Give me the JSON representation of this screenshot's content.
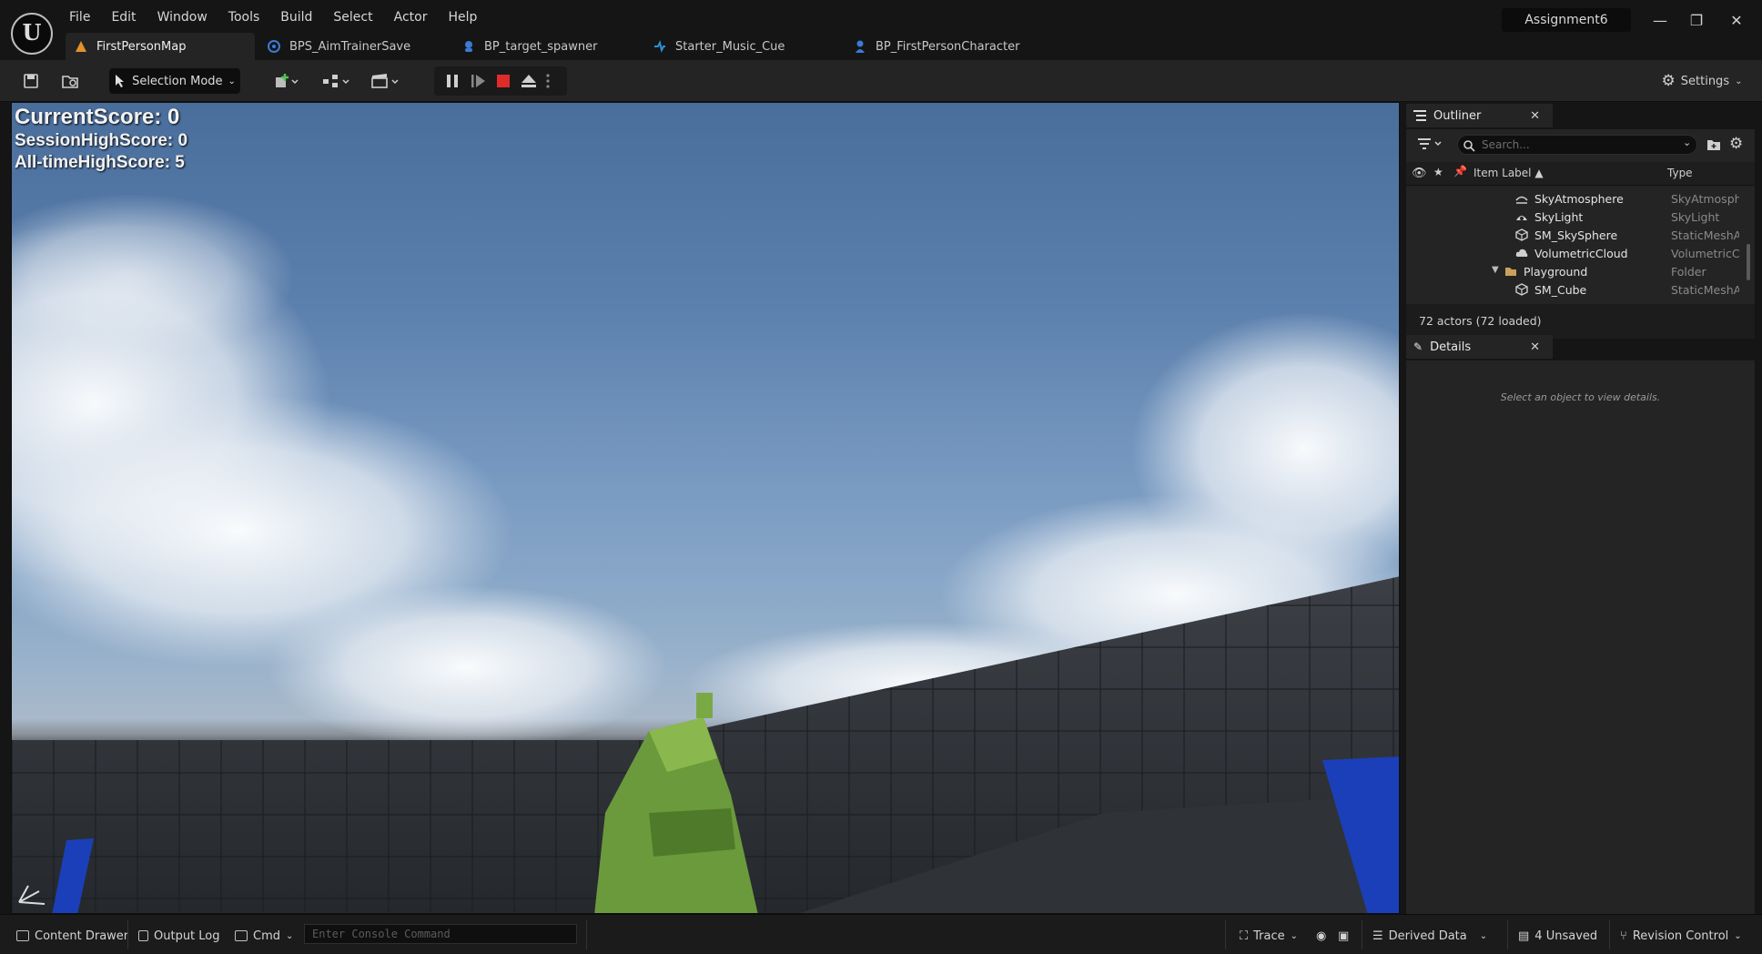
{
  "app": {
    "project_name": "Assignment6",
    "logo_glyph": "U",
    "menu": [
      "File",
      "Edit",
      "Window",
      "Tools",
      "Build",
      "Select",
      "Actor",
      "Help"
    ],
    "window_controls": {
      "minimize": "—",
      "restore": "❐",
      "close": "✕"
    }
  },
  "tabs": [
    {
      "label": "FirstPersonMap",
      "icon": "level-icon",
      "color": "#e0922c",
      "active": true
    },
    {
      "label": "BPS_AimTrainerSave",
      "icon": "savegame-blueprint-icon",
      "color": "#3a7bd5"
    },
    {
      "label": "BP_target_spawner",
      "icon": "actor-blueprint-icon",
      "color": "#3a7bd5"
    },
    {
      "label": "Starter_Music_Cue",
      "icon": "sound-cue-icon",
      "color": "#2f8fd8"
    },
    {
      "label": "BP_FirstPersonCharacter",
      "icon": "character-blueprint-icon",
      "color": "#3a7bd5"
    }
  ],
  "toolbar": {
    "selection_mode": "Selection Mode",
    "settings": "Settings",
    "stop_color": "#e02b2b"
  },
  "hud": {
    "current_score": "CurrentScore: 0",
    "session_high": "SessionHighScore: 0",
    "alltime_high": "All-timeHighScore: 5"
  },
  "outliner": {
    "title": "Outliner",
    "search_placeholder": "Search...",
    "columns": {
      "label": "Item Label ▲",
      "type": "Type"
    },
    "rows": [
      {
        "label": "SkyAtmosphere",
        "type": "SkyAtmosphere",
        "icon": "sky-atmosphere-icon"
      },
      {
        "label": "SkyLight",
        "type": "SkyLight",
        "icon": "skylight-icon"
      },
      {
        "label": "SM_SkySphere",
        "type": "StaticMeshActor",
        "icon": "static-mesh-icon"
      },
      {
        "label": "VolumetricCloud",
        "type": "VolumetricCloud",
        "icon": "cloud-icon"
      },
      {
        "label": "Playground",
        "type": "Folder",
        "icon": "folder-icon"
      },
      {
        "label": "SM_Cube",
        "type": "StaticMeshActor",
        "icon": "static-mesh-icon"
      }
    ],
    "actor_count": "72 actors (72 loaded)"
  },
  "details": {
    "title": "Details",
    "hint": "Select an object to view details."
  },
  "statusbar": {
    "content_drawer": "Content Drawer",
    "output_log": "Output Log",
    "cmd": "Cmd",
    "console_placeholder": "Enter Console Command",
    "trace": "Trace",
    "derived_data": "Derived Data",
    "unsaved": "4 Unsaved",
    "revision_control": "Revision Control"
  }
}
